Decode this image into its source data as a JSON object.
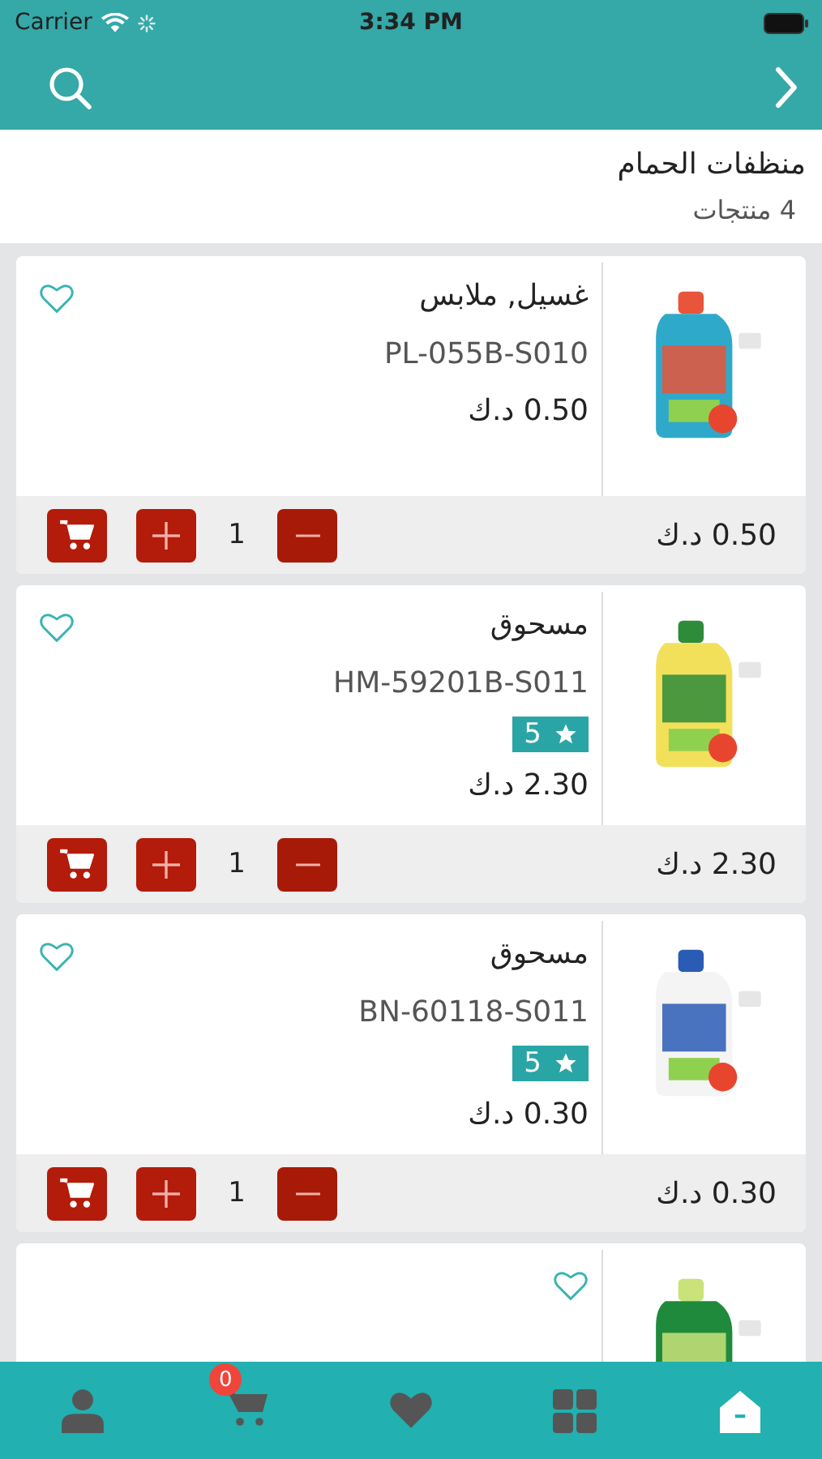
{
  "status_bar": {
    "carrier": "Carrier",
    "time": "3:34 PM"
  },
  "category": {
    "title": "منظفات الحمام",
    "count": "4 منتجات"
  },
  "products": [
    {
      "kind": "full",
      "name": "غسيل, ملابس",
      "sku": "PL-055B-S010",
      "price": "0.50 د.ك",
      "total": "0.50 د.ك",
      "qty": "1",
      "favorite": false
    },
    {
      "kind": "full",
      "name": "مسحوق",
      "sku": "HM-59201B-S011",
      "rating": "5",
      "price": "2.30 د.ك",
      "total": "2.30 د.ك",
      "qty": "1",
      "favorite": false
    },
    {
      "kind": "full",
      "name": "مسحوق",
      "sku": "BN-60118-S011",
      "rating": "5",
      "price": "0.30 د.ك",
      "total": "0.30 د.ك",
      "qty": "1",
      "favorite": false
    },
    {
      "kind": "partial",
      "favorite": false
    }
  ],
  "tab_bar": [
    {
      "kind": "account",
      "selected": false
    },
    {
      "kind": "cart",
      "badge": "0",
      "selected": false
    },
    {
      "kind": "favorites",
      "selected": false
    },
    {
      "kind": "categories",
      "selected": false
    },
    {
      "kind": "home",
      "selected": true
    }
  ]
}
